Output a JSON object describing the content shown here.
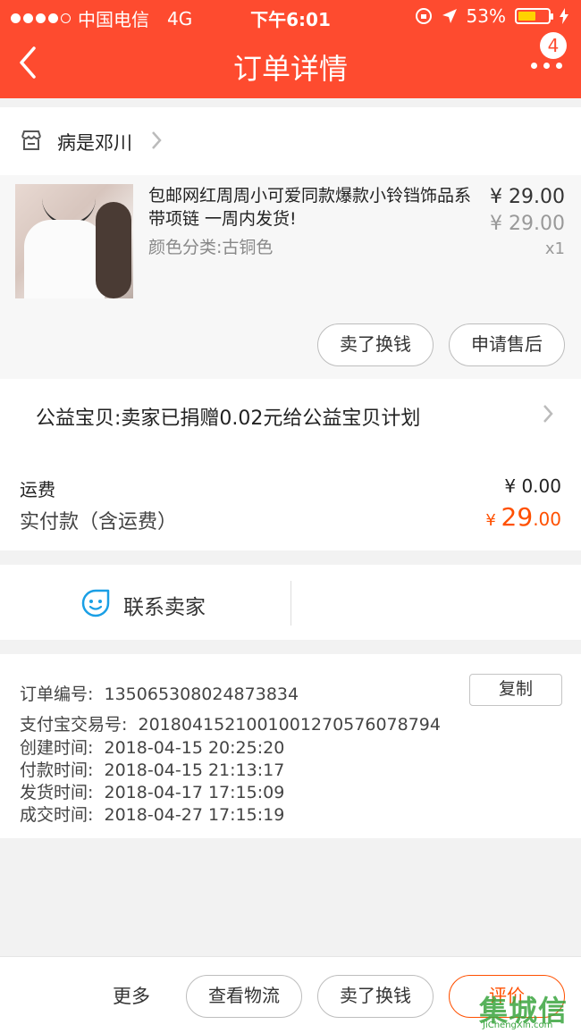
{
  "status_bar": {
    "carrier": "中国电信",
    "network": "4G",
    "time": "下午6:01",
    "battery": "53%"
  },
  "nav": {
    "title": "订单详情",
    "badge_count": "4"
  },
  "shop": {
    "name": "病是邓川"
  },
  "item": {
    "title": "包邮网红周周小可爱同款爆款小铃铛饰品系带项链 一周内发货!",
    "spec": "颜色分类:古铜色",
    "price": "¥ 29.00",
    "original_price": "¥ 29.00",
    "quantity": "x1",
    "buttons": {
      "sell": "卖了换钱",
      "after_sale": "申请售后"
    }
  },
  "charity": {
    "text": "公益宝贝:卖家已捐赠0.02元给公益宝贝计划"
  },
  "payment": {
    "shipping_label": "运费",
    "shipping_value": "¥ 0.00",
    "paid_label": "实付款（含运费）",
    "paid_currency": "¥ ",
    "paid_integer": "29",
    "paid_decimal": ".00"
  },
  "contact": {
    "label": "联系卖家"
  },
  "order_info": {
    "copy_label": "复制",
    "rows": [
      {
        "key": "订单编号:",
        "value": "135065308024873834"
      },
      {
        "key": "支付宝交易号:",
        "value": "2018041521001001270576078794"
      },
      {
        "key": "创建时间:",
        "value": "2018-04-15 20:25:20"
      },
      {
        "key": "付款时间:",
        "value": "2018-04-15 21:13:17"
      },
      {
        "key": "发货时间:",
        "value": "2018-04-17 17:15:09"
      },
      {
        "key": "成交时间:",
        "value": "2018-04-27 17:15:19"
      }
    ]
  },
  "bottom_bar": {
    "more": "更多",
    "logistics": "查看物流",
    "sell": "卖了换钱",
    "review": "评价"
  },
  "watermark": {
    "big": "集城信",
    "small": "JiChengXin.com"
  },
  "colors": {
    "brand": "#fe4b2f",
    "price": "#ff5000",
    "contact_icon": "#1a9fe5"
  }
}
